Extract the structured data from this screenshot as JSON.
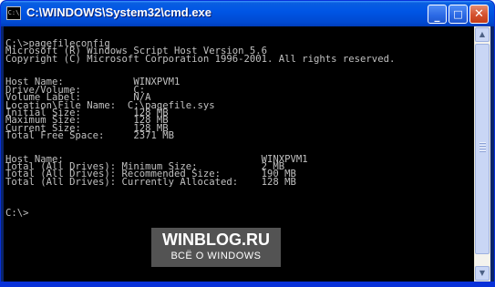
{
  "window": {
    "title": "C:\\WINDOWS\\System32\\cmd.exe",
    "icon_text": "C:\\",
    "buttons": {
      "minimize": "_",
      "maximize": "□",
      "close": "✕"
    }
  },
  "console": {
    "lines": [
      "C:\\>pagefileconfig",
      "Microsoft (R) Windows Script Host Version 5.6",
      "Copyright (C) Microsoft Corporation 1996-2001. All rights reserved.",
      "",
      "",
      "Host Name:            WINXPVM1",
      "Drive/Volume:         C:",
      "Volume Label:         N/A",
      "Location\\File Name:  C:\\pagefile.sys",
      "Initial Size:         128 MB",
      "Maximum Size:         128 MB",
      "Current Size:         128 MB",
      "Total Free Space:     2371 MB",
      "",
      "",
      "Host Name:                                  WINXPVM1",
      "Total (All Drives): Minimum Size:           2 MB",
      "Total (All Drives): Recommended Size:       190 MB",
      "Total (All Drives): Currently Allocated:    128 MB",
      "",
      "",
      "",
      "C:\\>"
    ]
  },
  "scrollbar": {
    "up_arrow": "▲",
    "down_arrow": "▼"
  },
  "watermark": {
    "title": "WINBLOG.RU",
    "subtitle": "ВСЁ О WINDOWS"
  }
}
